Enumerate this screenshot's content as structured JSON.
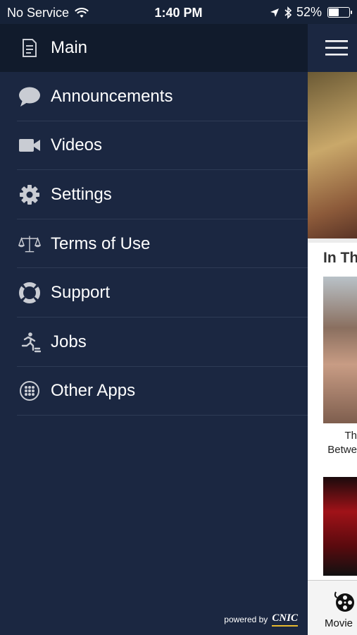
{
  "status_bar": {
    "carrier": "No Service",
    "time": "1:40 PM",
    "battery": "52%",
    "battery_level": 0.52
  },
  "menu": {
    "items": [
      {
        "label": "Main",
        "icon": "document-icon",
        "active": true
      },
      {
        "label": "Announcements",
        "icon": "speech-bubble-icon"
      },
      {
        "label": "Videos",
        "icon": "video-camera-icon"
      },
      {
        "label": "Settings",
        "icon": "gear-icon"
      },
      {
        "label": "Terms of Use",
        "icon": "scales-icon"
      },
      {
        "label": "Support",
        "icon": "lifebuoy-icon"
      },
      {
        "label": "Jobs",
        "icon": "running-person-icon"
      },
      {
        "label": "Other Apps",
        "icon": "grid-dots-icon"
      }
    ]
  },
  "footer": {
    "powered_by": "powered by",
    "logo": "CNIC"
  },
  "content": {
    "section_title": "In Th",
    "caption_line1": "Th",
    "caption_line2": "Betwe",
    "tab_label": "Movie"
  },
  "colors": {
    "drawer_bg": "#1b2741",
    "active_bg": "#111b2c",
    "icon": "#c9ccd3",
    "accent_gold": "#e8b92f"
  }
}
